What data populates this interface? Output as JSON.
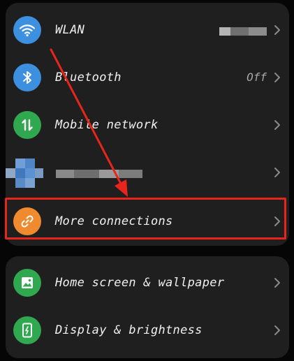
{
  "settings": {
    "rows": [
      {
        "id": "wlan",
        "label": "WLAN",
        "value": "",
        "icon": "wifi-icon",
        "icon_color": "#3d8fe0"
      },
      {
        "id": "bluetooth",
        "label": "Bluetooth",
        "value": "Off",
        "icon": "bluetooth-icon",
        "icon_color": "#3d8fe0"
      },
      {
        "id": "mobile-network",
        "label": "Mobile network",
        "value": "",
        "icon": "mobile-data-icon",
        "icon_color": "#2fa84f"
      },
      {
        "id": "hidden",
        "label": "",
        "value": "",
        "icon": "blurred-icon",
        "icon_color": "#4f86c6"
      },
      {
        "id": "more-connections",
        "label": "More connections",
        "value": "",
        "icon": "link-icon",
        "icon_color": "#ef8a2e"
      }
    ],
    "rows2": [
      {
        "id": "home-screen",
        "label": "Home screen & wallpaper",
        "value": "",
        "icon": "picture-icon",
        "icon_color": "#2fa84f"
      },
      {
        "id": "display",
        "label": "Display & brightness",
        "value": "",
        "icon": "display-icon",
        "icon_color": "#2fa84f"
      }
    ]
  },
  "annotation": {
    "highlight_color": "#e8251c"
  }
}
